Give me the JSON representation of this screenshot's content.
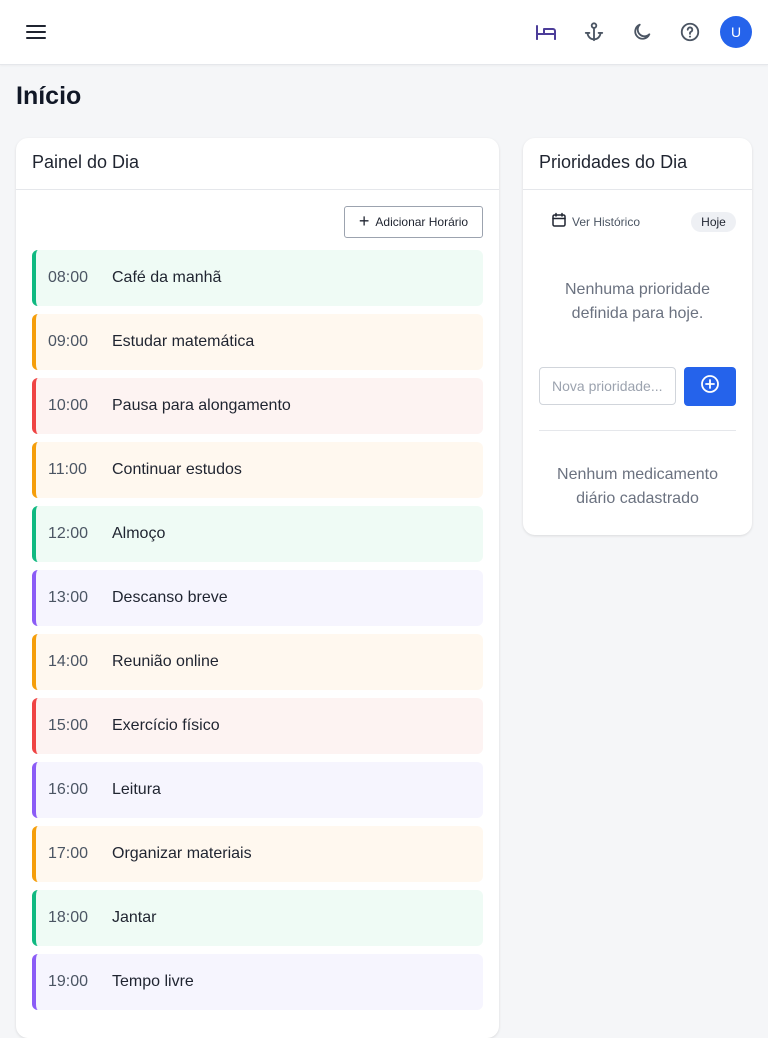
{
  "header": {
    "menu_icon": "hamburger-menu-icon",
    "actions": [
      {
        "icon": "bed-icon",
        "color": "#4c3d99"
      },
      {
        "icon": "anchor-icon",
        "color": "#4b5563"
      },
      {
        "icon": "moon-icon",
        "color": "#4b5563"
      },
      {
        "icon": "help-circle-icon",
        "color": "#4b5563"
      }
    ],
    "avatar_initial": "U",
    "avatar_color": "#2563eb"
  },
  "page": {
    "title": "Início"
  },
  "daily_panel": {
    "title": "Painel do Dia",
    "add_button_label": "Adicionar Horário",
    "items": [
      {
        "time": "08:00",
        "label": "Café da manhã",
        "accent": "#10b981",
        "bg": "#effbf5"
      },
      {
        "time": "09:00",
        "label": "Estudar matemática",
        "accent": "#f59e0b",
        "bg": "#fff8ef"
      },
      {
        "time": "10:00",
        "label": "Pausa para alongamento",
        "accent": "#ef4444",
        "bg": "#fdf3f2"
      },
      {
        "time": "11:00",
        "label": "Continuar estudos",
        "accent": "#f59e0b",
        "bg": "#fff8ef"
      },
      {
        "time": "12:00",
        "label": "Almoço",
        "accent": "#10b981",
        "bg": "#effbf5"
      },
      {
        "time": "13:00",
        "label": "Descanso breve",
        "accent": "#8b5cf6",
        "bg": "#f6f5fe"
      },
      {
        "time": "14:00",
        "label": "Reunião online",
        "accent": "#f59e0b",
        "bg": "#fff8ef"
      },
      {
        "time": "15:00",
        "label": "Exercício físico",
        "accent": "#ef4444",
        "bg": "#fdf3f2"
      },
      {
        "time": "16:00",
        "label": "Leitura",
        "accent": "#8b5cf6",
        "bg": "#f6f5fe"
      },
      {
        "time": "17:00",
        "label": "Organizar materiais",
        "accent": "#f59e0b",
        "bg": "#fff8ef"
      },
      {
        "time": "18:00",
        "label": "Jantar",
        "accent": "#10b981",
        "bg": "#effbf5"
      },
      {
        "time": "19:00",
        "label": "Tempo livre",
        "accent": "#8b5cf6",
        "bg": "#f6f5fe"
      }
    ]
  },
  "priorities": {
    "title": "Prioridades do Dia",
    "history_label": "Ver Histórico",
    "today_label": "Hoje",
    "empty_line1": "Nenhuma prioridade",
    "empty_line2": "definida para hoje.",
    "input_placeholder": "Nova prioridade...",
    "add_icon": "plus-circle-icon",
    "add_color": "#2563eb",
    "meds_line1": "Nenhum medicamento",
    "meds_line2": "diário cadastrado"
  }
}
